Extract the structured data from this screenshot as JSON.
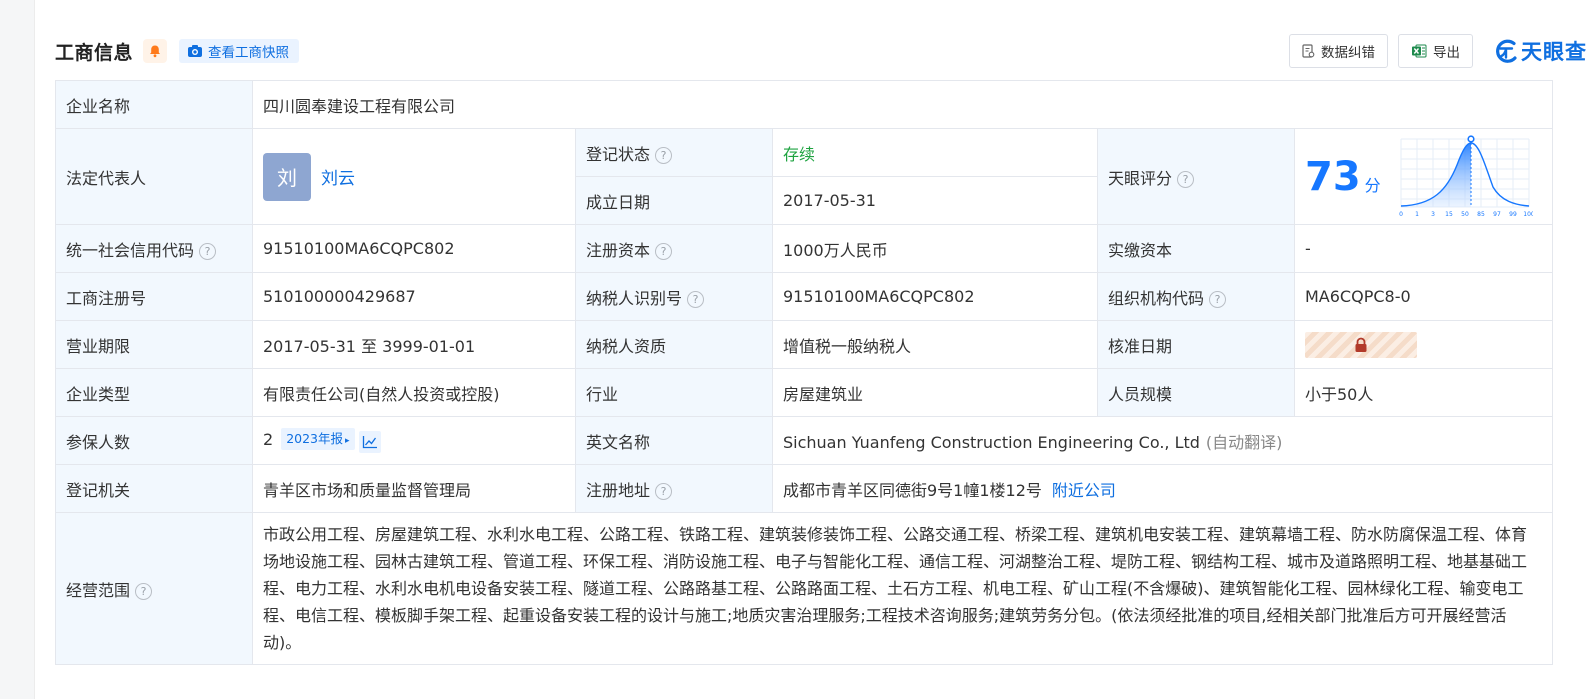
{
  "header": {
    "title": "工商信息",
    "snapshot_label": "查看工商快照",
    "correction_label": "数据纠错",
    "export_label": "导出",
    "logo_text": "天眼查"
  },
  "colors": {
    "accent": "#0f6fe0",
    "label_bg": "#f2f8fe",
    "status_green": "#1ea340",
    "score_blue": "#1677ff"
  },
  "company": {
    "name_label": "企业名称",
    "name": "四川圆奉建设工程有限公司",
    "legal_rep_label": "法定代表人",
    "legal_rep_avatar": "刘",
    "legal_rep_name": "刘云",
    "status_label": "登记状态",
    "status": "存续",
    "established_label": "成立日期",
    "established": "2017-05-31",
    "score_label": "天眼评分",
    "score": "73",
    "score_unit": "分",
    "score_axis": [
      "0",
      "1",
      "3",
      "15",
      "50",
      "85",
      "97",
      "99",
      "100"
    ],
    "credit_code_label": "统一社会信用代码",
    "credit_code": "91510100MA6CQPC802",
    "reg_capital_label": "注册资本",
    "reg_capital": "1000万人民币",
    "paid_capital_label": "实缴资本",
    "paid_capital": "-",
    "biz_reg_no_label": "工商注册号",
    "biz_reg_no": "510100000429687",
    "taxpayer_id_label": "纳税人识别号",
    "taxpayer_id": "91510100MA6CQPC802",
    "org_code_label": "组织机构代码",
    "org_code": "MA6CQPC8-0",
    "term_label": "营业期限",
    "term": "2017-05-31 至 3999-01-01",
    "taxpayer_qual_label": "纳税人资质",
    "taxpayer_qual": "增值税一般纳税人",
    "approval_date_label": "核准日期",
    "type_label": "企业类型",
    "type": "有限责任公司(自然人投资或控股)",
    "industry_label": "行业",
    "industry": "房屋建筑业",
    "staff_size_label": "人员规模",
    "staff_size": "小于50人",
    "insured_label": "参保人数",
    "insured": "2",
    "insured_report": "2023年报",
    "english_name_label": "英文名称",
    "english_name": "Sichuan Yuanfeng Construction Engineering Co., Ltd",
    "english_name_note": "(自动翻译)",
    "authority_label": "登记机关",
    "authority": "青羊区市场和质量监督管理局",
    "address_label": "注册地址",
    "address": "成都市青羊区同德街9号1幢1楼12号",
    "nearby_label": "附近公司",
    "scope_label": "经营范围",
    "scope": "市政公用工程、房屋建筑工程、水利水电工程、公路工程、铁路工程、建筑装修装饰工程、公路交通工程、桥梁工程、建筑机电安装工程、建筑幕墙工程、防水防腐保温工程、体育场地设施工程、园林古建筑工程、管道工程、环保工程、消防设施工程、电子与智能化工程、通信工程、河湖整治工程、堤防工程、钢结构工程、城市及道路照明工程、地基基础工程、电力工程、水利水电机电设备安装工程、隧道工程、公路路基工程、公路路面工程、土石方工程、机电工程、矿山工程(不含爆破)、建筑智能化工程、园林绿化工程、输变电工程、电信工程、模板脚手架工程、起重设备安装工程的设计与施工;地质灾害治理服务;工程技术咨询服务;建筑劳务分包。(依法须经批准的项目,经相关部门批准后方可开展经营活动)。"
  }
}
